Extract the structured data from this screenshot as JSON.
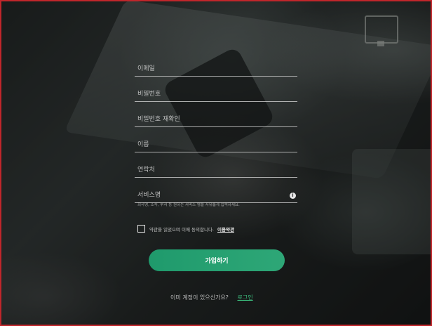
{
  "form": {
    "fields": [
      {
        "placeholder": "이메일"
      },
      {
        "placeholder": "비밀번호"
      },
      {
        "placeholder": "비밀번호 재확인"
      },
      {
        "placeholder": "이름"
      },
      {
        "placeholder": "연락처"
      },
      {
        "placeholder": "서비스명"
      }
    ],
    "service_hint": "회사명, 소속, 부서 등 원하는 서비스 명을 자유롭게 입력하세요.",
    "info_icon_glyph": "i",
    "agree_text": "약관을 읽었으며 이에 동의합니다.",
    "terms_link": "이용약관",
    "signup_label": "가입하기",
    "login_question": "이미 계정이 있으신가요?",
    "login_link": "로그인"
  },
  "colors": {
    "accent": "#2ea777",
    "link": "#3cc07f",
    "frame_border": "#c0262b"
  }
}
